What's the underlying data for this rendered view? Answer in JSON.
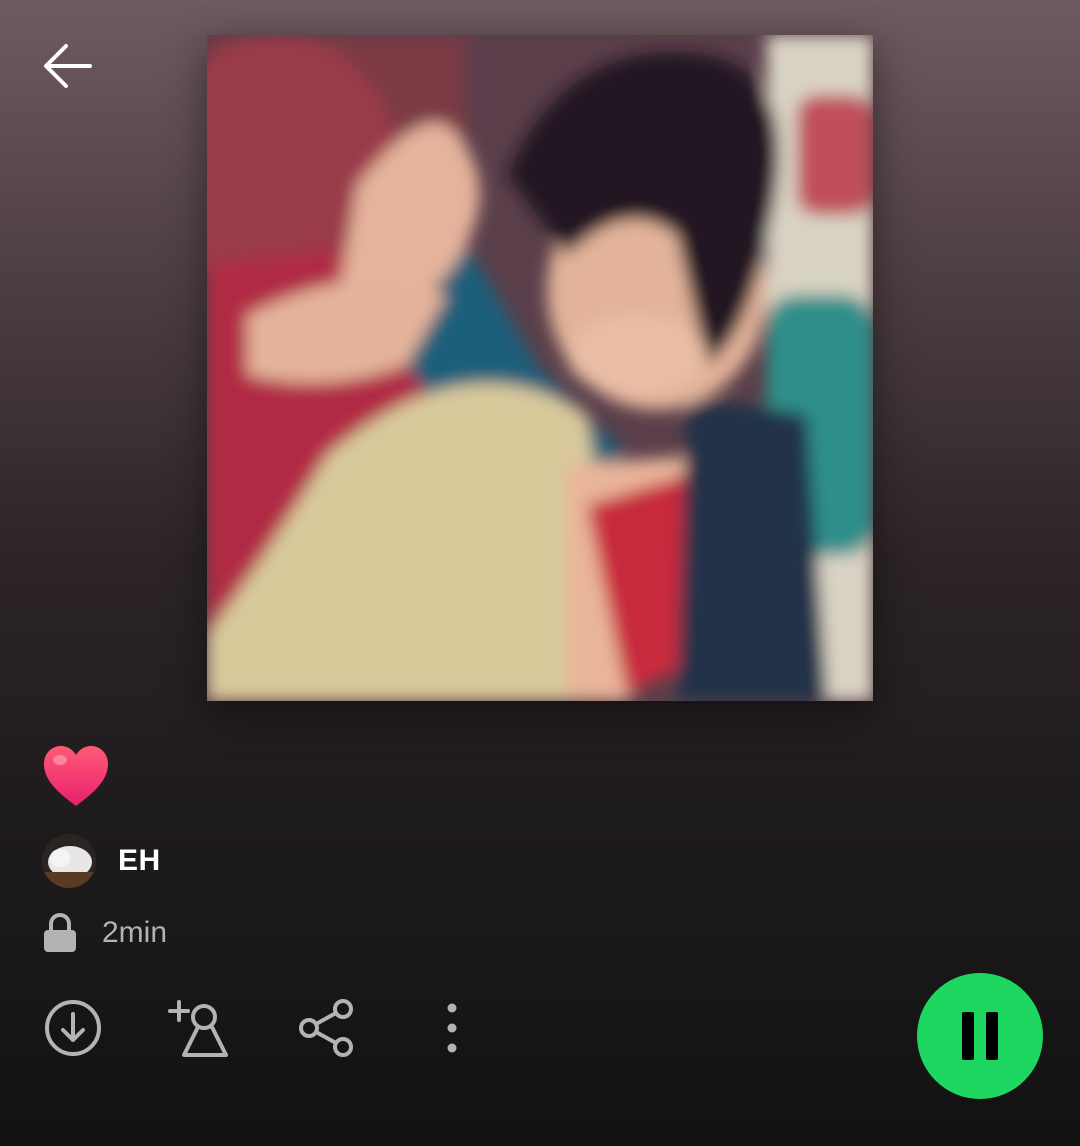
{
  "playlist": {
    "title_emoji": "heart",
    "owner_name": "EH",
    "duration": "2min",
    "visibility": "lock-icon"
  },
  "icons": {
    "back": "arrow-left-icon",
    "download": "download-circle-icon",
    "add_collaborator": "add-person-icon",
    "share": "share-icon",
    "more": "more-vertical-icon",
    "play_state": "pause-icon"
  },
  "colors": {
    "accent": "#1ed760",
    "text_primary": "#ffffff",
    "text_secondary": "#b3b3b3",
    "heart": "#ff3d6e"
  }
}
